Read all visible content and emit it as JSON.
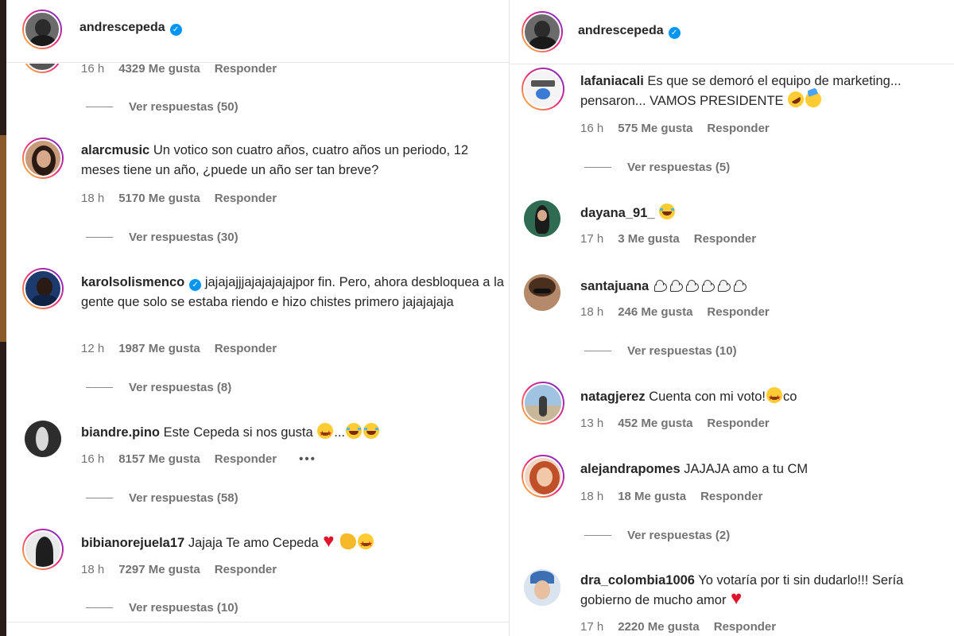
{
  "left": {
    "header": {
      "username": "andrescepeda",
      "verified": "✓"
    },
    "top_meta": {
      "time": "16 h",
      "likes": "4329 Me gusta",
      "reply": "Responder"
    },
    "top_replies": "Ver respuestas (50)",
    "comments": [
      {
        "user": "alarcmusic",
        "text": "Un votico son cuatro años, cuatro años un periodo, 12 meses tiene un año, ¿puede un año ser tan breve?",
        "time": "18 h",
        "likes": "5170 Me gusta",
        "reply": "Responder",
        "replies": "Ver respuestas (30)"
      },
      {
        "user": "karolsolismenco",
        "verified": "✓",
        "text": "jajajajjjajajajajajpor fin. Pero, ahora desbloquea a la gente que solo se estaba riendo e hizo chistes primero jajajajaja",
        "time": "12 h",
        "likes": "1987 Me gusta",
        "reply": "Responder",
        "replies": "Ver respuestas (8)"
      },
      {
        "user": "biandre.pino",
        "text": "Este Cepeda si nos gusta",
        "text_after": "...",
        "time": "16 h",
        "likes": "8157 Me gusta",
        "reply": "Responder",
        "more": "•••",
        "replies": "Ver respuestas (58)"
      },
      {
        "user": "bibianorejuela17",
        "text": "Jajaja Te amo Cepeda",
        "time": "18 h",
        "likes": "7297 Me gusta",
        "reply": "Responder",
        "replies": "Ver respuestas (10)"
      }
    ]
  },
  "right": {
    "header": {
      "username": "andrescepeda",
      "verified": "✓"
    },
    "comments": [
      {
        "user": "lafaniacali",
        "text": "Es que se demoró el equipo de marketing... pensaron... VAMOS PRESIDENTE",
        "time": "16 h",
        "likes": "575 Me gusta",
        "reply": "Responder",
        "replies": "Ver respuestas (5)"
      },
      {
        "user": "dayana_91_",
        "text": "",
        "time": "17 h",
        "likes": "3 Me gusta",
        "reply": "Responder"
      },
      {
        "user": "santajuana",
        "text": "",
        "time": "18 h",
        "likes": "246 Me gusta",
        "reply": "Responder",
        "replies": "Ver respuestas (10)"
      },
      {
        "user": "natagjerez",
        "text": "Cuenta con mi voto!",
        "text_after": "co",
        "time": "13 h",
        "likes": "452 Me gusta",
        "reply": "Responder"
      },
      {
        "user": "alejandrapomes",
        "text": "JAJAJA amo a tu CM",
        "time": "18 h",
        "likes": "18 Me gusta",
        "reply": "Responder",
        "replies": "Ver respuestas (2)"
      },
      {
        "user": "dra_colombia1006",
        "text": "Yo votaría por ti sin dudarlo!!! Sería gobierno de mucho amor",
        "time": "17 h",
        "likes": "2220 Me gusta",
        "reply": "Responder"
      }
    ]
  },
  "colors": {
    "text": "#262626",
    "meta": "#737373",
    "verified": "#0095f6",
    "story_ring": "#ee2a7b"
  }
}
